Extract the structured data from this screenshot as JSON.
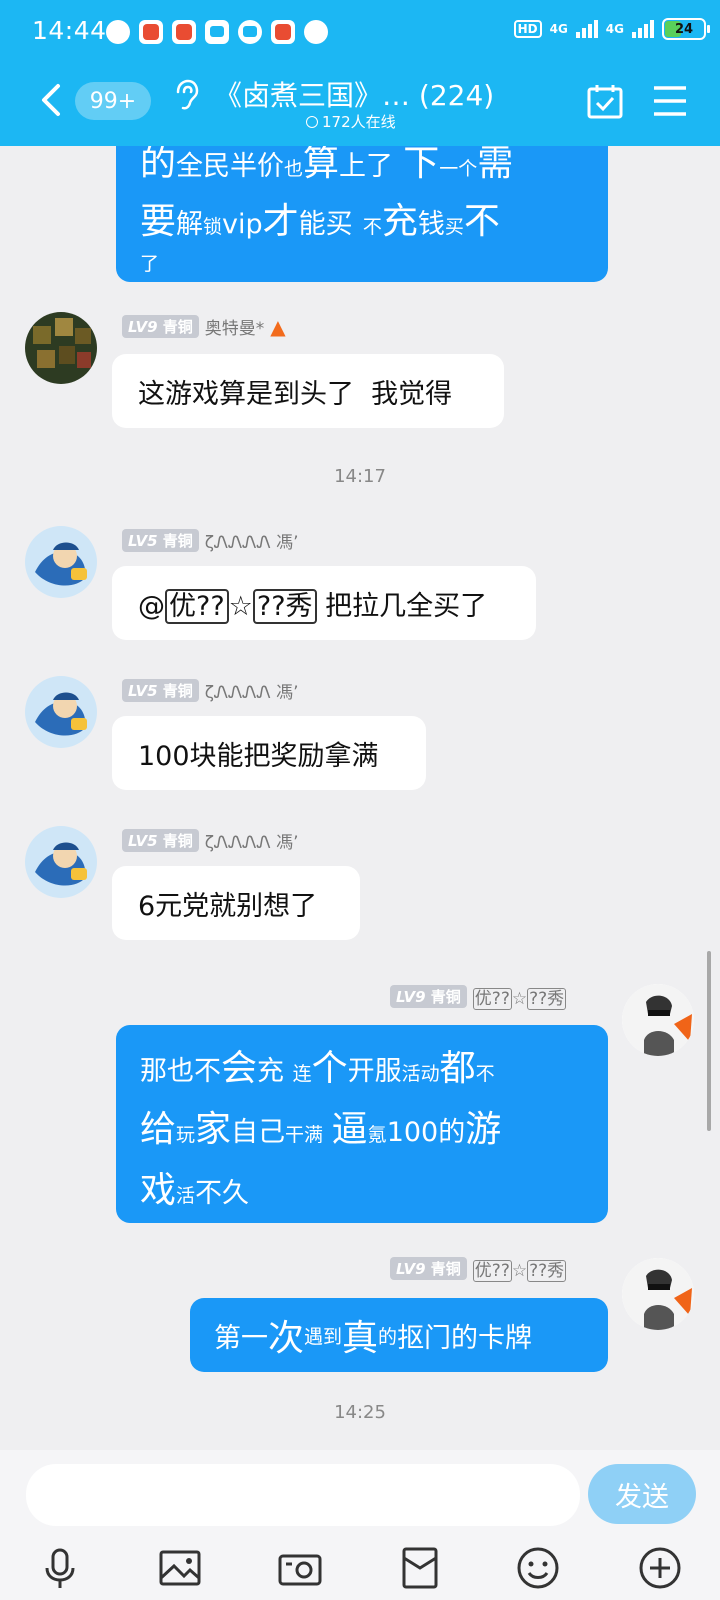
{
  "status_bar": {
    "time": "14:44",
    "network": "4G",
    "network2": "4G",
    "battery": "24",
    "hd": "HD"
  },
  "header": {
    "unread_badge": "99+",
    "title": "《卤煮三国》… (224)",
    "online": "172人在线"
  },
  "messages": {
    "m0": {
      "text_parts": [
        "的",
        "全民半价",
        "也",
        "算",
        "上",
        "了",
        "下",
        "一个",
        "需",
        "要",
        "解",
        "锁",
        "vip",
        "才",
        "能买",
        "不",
        "充",
        "钱",
        "买",
        "不",
        "了"
      ]
    },
    "m1": {
      "level": "LV9",
      "rank": "青铜",
      "user": "奥特曼*",
      "text": "这游戏算是到头了  我觉得"
    },
    "ts1": "14:17",
    "m2": {
      "level": "LV5",
      "rank": "青铜",
      "user": "ζᏁᏁᏁᏁ 馮’",
      "mention_at": "@",
      "mention_part1": "优??",
      "mention_star": "☆",
      "mention_part2": "??秀",
      "text_after": " 把拉几全买了"
    },
    "m3": {
      "level": "LV5",
      "rank": "青铜",
      "user": "ζᏁᏁᏁᏁ 馮’",
      "text": "100块能把奖励拿满"
    },
    "m4": {
      "level": "LV5",
      "rank": "青铜",
      "user": "ζᏁᏁᏁᏁ 馮’",
      "text": "6元党就别想了"
    },
    "m5": {
      "level": "LV9",
      "rank": "青铜",
      "user_part1": "优??",
      "user_star": "☆",
      "user_part2": "??秀"
    },
    "m6": {
      "level": "LV9",
      "rank": "青铜",
      "user_part1": "优??",
      "user_star": "☆",
      "user_part2": "??秀"
    },
    "ts2": "14:25"
  },
  "input": {
    "send_label": "发送"
  },
  "toolbar_icons": [
    "mic-icon",
    "image-icon",
    "camera-icon",
    "red-packet-icon",
    "emoji-icon",
    "plus-icon"
  ]
}
